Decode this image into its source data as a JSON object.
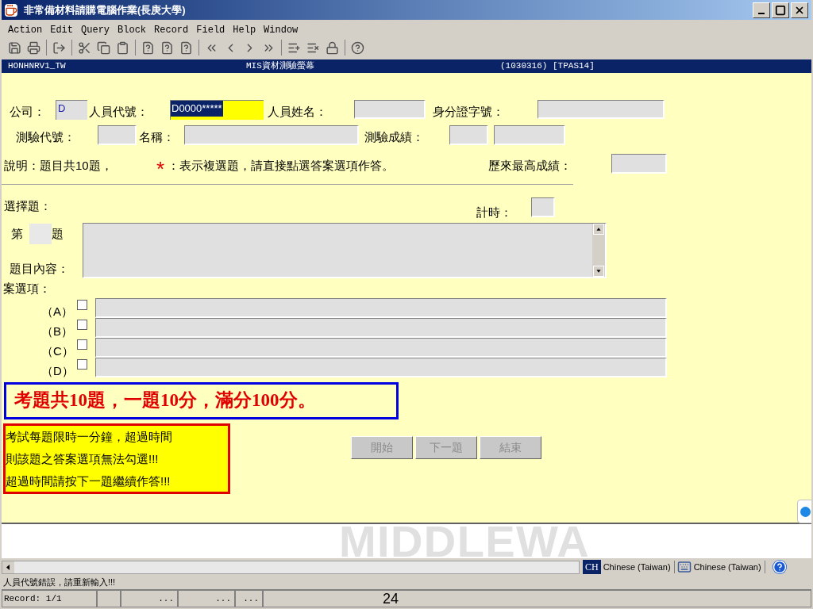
{
  "window": {
    "title": "非常備材料請購電腦作業(長庚大學)"
  },
  "menu": [
    "Action",
    "Edit",
    "Query",
    "Block",
    "Record",
    "Field",
    "Help",
    "Window"
  ],
  "form_header": {
    "left": "HONHNRV1_TW",
    "center": "MIS資材測驗螢幕",
    "right": "(1030316) [TPAS14]"
  },
  "row1": {
    "company_label": "公司：",
    "company_value": "D",
    "code_label": "人員代號：",
    "code_value": "D0000*****",
    "code_selected": true,
    "name_label": "人員姓名：",
    "id_label": "身分證字號："
  },
  "row2": {
    "test_code_label": "測驗代號：",
    "test_name_label": "名稱：",
    "score_label": "測驗成績："
  },
  "note": {
    "text": "說明：題目共10題，",
    "asterisk": "*",
    "text2": "：表示複選題，請直接點選答案選項作答。",
    "best_label": "歷來最高成績："
  },
  "quiz": {
    "section_label": "選擇題：",
    "timer_label": "計時：",
    "number_prefix": "第",
    "number_suffix": "題",
    "content_label": "題目內容：",
    "options_label": "案選項："
  },
  "options": [
    {
      "letter": "（A）",
      "checked": false
    },
    {
      "letter": "（B）",
      "checked": false
    },
    {
      "letter": "（C）",
      "checked": false
    },
    {
      "letter": "（D）",
      "checked": false
    }
  ],
  "callout_blue": "考題共10題，一題10分，滿分100分。",
  "callout_red": [
    "考試每題限時一分鐘，超過時間",
    "則該題之答案選項無法勾選!!!",
    "超過時間請按下一題繼續作答!!!"
  ],
  "buttons": [
    {
      "label": "開始",
      "disabled": true
    },
    {
      "label": "下一題",
      "disabled": true
    },
    {
      "label": "結束",
      "disabled": true
    }
  ],
  "background_text": "MIDDLEWA",
  "language": {
    "badge": "CH",
    "input": "Chinese (Taiwan)",
    "keyboard": "Chinese (Taiwan)"
  },
  "message": "人員代號錯誤，請重新輸入!!!",
  "status": {
    "record": "Record: 1/1",
    "cells": [
      "...",
      "...",
      "..."
    ]
  },
  "page_number": "24"
}
